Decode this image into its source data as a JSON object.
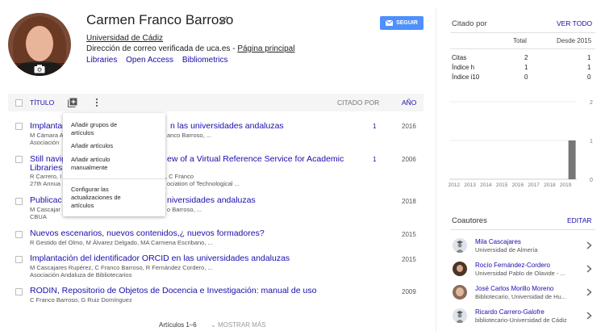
{
  "profile": {
    "name": "Carmen Franco Barroso",
    "affiliation": "Universidad de Cádiz",
    "email_text": "Dirección de correo verificada de uca.es - ",
    "homepage": "Página principal",
    "tags": [
      "Libraries",
      "Open Access",
      "Bibliometrics"
    ],
    "follow_label": "SEGUIR"
  },
  "table": {
    "title_header": "TÍTULO",
    "cited_header": "CITADO POR",
    "year_header": "AÑO",
    "articles": [
      {
        "title": "Implantación …en las universidades andaluzas",
        "title_visible_left": "Implantac",
        "title_visible_right": "n las universidades andaluzas",
        "authors_left": "M Cámara A",
        "authors_right": "anco Barroso, ...",
        "venue": "Asociación",
        "cited": "1",
        "year": "2016"
      },
      {
        "title_visible_left": "Still navig",
        "title_visible_right": "ew of a Virtual Reference Service for Academic",
        "title_line2": "Libraries",
        "authors_left": "R Carrero, I",
        "authors_right": ", C Franco",
        "venue_left": "27th Annua",
        "venue_right": "ociation of Technological ...",
        "cited": "1",
        "year": "2006"
      },
      {
        "title_visible_left": "Publicac",
        "title_visible_right": "niversidades andaluzas",
        "authors_left": "M Cascajar",
        "authors_right": "o Barroso, ...",
        "venue": "CBUA",
        "cited": "",
        "year": "2018"
      },
      {
        "title": "Nuevos escenarios, nuevos contenidos,¿ nuevos formadores?",
        "authors": "R Gestido del Olmo, M Álvarez Delgado, MA Carmena Escribano, ...",
        "cited": "",
        "year": "2015"
      },
      {
        "title": "Implantación del identificador ORCID en las universidades andaluzas",
        "authors": "M Cascajares Rupérez, C Franco Barroso, R Fernández Cordero, ...",
        "venue": "Asociación Andaluza de Bibliotecarios",
        "cited": "",
        "year": "2015"
      },
      {
        "title": "RODIN, Repositorio de Objetos de Docencia e Investigación: manual de uso",
        "authors": "C Franco Barroso, G Ruiz Domínguez",
        "cited": "",
        "year": "2009"
      }
    ],
    "footer_count": "Artículos 1–6",
    "show_more": "MOSTRAR MÁS"
  },
  "menu": {
    "items": [
      "Añadir grupos de artículos",
      "Añadir artículos",
      "Añadir artículo manualmente",
      "Configurar las actualizaciones de artículos"
    ]
  },
  "cited_by": {
    "title": "Citado por",
    "view_all": "VER TODO",
    "col_total": "Total",
    "col_since": "Desde 2015",
    "rows": [
      {
        "label": "Citas",
        "total": "2",
        "since": "1"
      },
      {
        "label": "Índice h",
        "total": "1",
        "since": "1"
      },
      {
        "label": "Índice i10",
        "total": "0",
        "since": "0"
      }
    ]
  },
  "chart_data": {
    "type": "bar",
    "categories": [
      "2012",
      "2013",
      "2014",
      "2015",
      "2016",
      "2017",
      "2018",
      "2019"
    ],
    "values": [
      0,
      0,
      0,
      0,
      0,
      0,
      0,
      1
    ],
    "ylim": [
      0,
      2
    ],
    "y_ticks": [
      "2",
      "1",
      "0"
    ],
    "bar_color": "#777777"
  },
  "coauthors": {
    "title": "Coautores",
    "edit": "EDITAR",
    "items": [
      {
        "name": "Mila Cascajares",
        "aff": "Universidad de Almería"
      },
      {
        "name": "Rocío Fernández-Cordero",
        "aff": "Universidad Pablo de Olavide - ..."
      },
      {
        "name": "José Carlos Morillo Moreno",
        "aff": "Bibliotecario, Universidad de Hu..."
      },
      {
        "name": "Ricardo Carrero-Galofre",
        "aff": "bibliotecario-Universidad de Cádiz"
      }
    ]
  },
  "colors": {
    "accent": "#4d90fe",
    "link": "#1a0dab"
  }
}
